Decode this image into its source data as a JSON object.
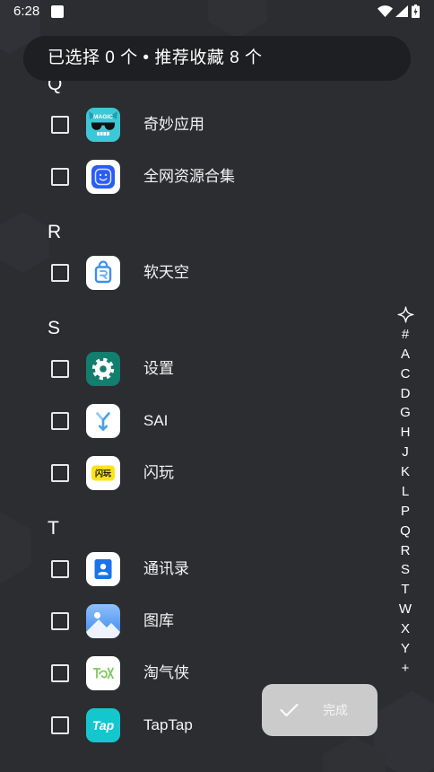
{
  "theme": {
    "background": "#2c2d31",
    "banner": "#1e1f22",
    "text": "#ffffff",
    "done_button_bg": "#cbcbcb",
    "done_button_fg": "#f5f5f5"
  },
  "status_bar": {
    "time": "6:28",
    "icons": [
      "notification-square-icon",
      "wifi-icon",
      "signal-icon",
      "battery-charging-icon"
    ]
  },
  "banner": {
    "text": "已选择 0 个 • 推荐收藏 8 个"
  },
  "sections": [
    {
      "letter": "Q",
      "apps": [
        {
          "name": "奇妙应用",
          "icon": "magic-app-icon",
          "icon_text": "MAGIC",
          "checked": false
        },
        {
          "name": "全网资源合集",
          "icon": "all-resources-icon",
          "checked": false
        }
      ]
    },
    {
      "letter": "R",
      "apps": [
        {
          "name": "软天空",
          "icon": "ruantiankong-icon",
          "checked": false
        }
      ]
    },
    {
      "letter": "S",
      "apps": [
        {
          "name": "设置",
          "icon": "settings-gear-icon",
          "checked": false
        },
        {
          "name": "SAI",
          "icon": "sai-icon",
          "checked": false
        },
        {
          "name": "闪玩",
          "icon": "shanwan-icon",
          "icon_text": "闪玩",
          "checked": false
        }
      ]
    },
    {
      "letter": "T",
      "apps": [
        {
          "name": "通讯录",
          "icon": "contacts-icon",
          "checked": false
        },
        {
          "name": "图库",
          "icon": "gallery-icon",
          "checked": false
        },
        {
          "name": "淘气侠",
          "icon": "taoqixia-icon",
          "checked": false
        },
        {
          "name": "TapTap",
          "icon": "taptap-icon",
          "icon_text": "Tap",
          "checked": false
        }
      ]
    }
  ],
  "alphabet_index": {
    "top_icon": "sparkle-star-icon",
    "letters": [
      "#",
      "A",
      "C",
      "D",
      "G",
      "H",
      "J",
      "K",
      "L",
      "P",
      "Q",
      "R",
      "S",
      "T",
      "W",
      "X",
      "Y",
      "+"
    ]
  },
  "done_button": {
    "label": "完成",
    "icon": "check-icon",
    "disabled": true
  }
}
